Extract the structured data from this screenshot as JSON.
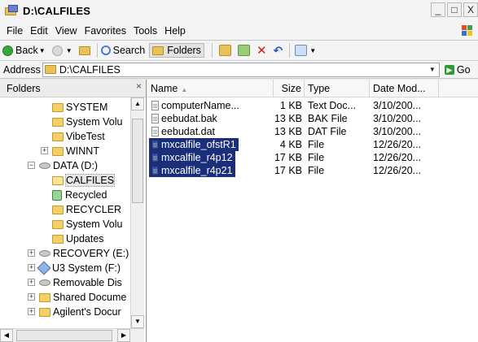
{
  "window": {
    "title": "D:\\CALFILES",
    "controls": {
      "minimize": "_",
      "maximize": "□",
      "close": "X"
    }
  },
  "menu": [
    "File",
    "Edit",
    "View",
    "Favorites",
    "Tools",
    "Help"
  ],
  "toolbar": {
    "back_label": "Back",
    "search_label": "Search",
    "folders_label": "Folders"
  },
  "address": {
    "label": "Address",
    "value": "D:\\CALFILES",
    "go_label": "Go"
  },
  "folders_pane": {
    "title": "Folders",
    "items": [
      {
        "label": "SYSTEM",
        "type": "folder"
      },
      {
        "label": "System Volu",
        "type": "folder"
      },
      {
        "label": "VibeTest",
        "type": "folder"
      },
      {
        "label": "WINNT",
        "type": "folder",
        "expander": "+"
      },
      {
        "label": "DATA (D:)",
        "type": "drive",
        "expander": "−"
      },
      {
        "label": "CALFILES",
        "type": "folder-open",
        "selected": true
      },
      {
        "label": "Recycled",
        "type": "recycle"
      },
      {
        "label": "RECYCLER",
        "type": "folder"
      },
      {
        "label": "System Volu",
        "type": "folder"
      },
      {
        "label": "Updates",
        "type": "folder"
      },
      {
        "label": "RECOVERY (E:)",
        "type": "drive",
        "expander": "+"
      },
      {
        "label": "U3 System (F:)",
        "type": "usb",
        "expander": "+"
      },
      {
        "label": "Removable Dis",
        "type": "drive",
        "expander": "+"
      },
      {
        "label": "Shared Docume",
        "type": "folder",
        "expander": "+"
      },
      {
        "label": "Agilent's Docur",
        "type": "folder",
        "expander": "+"
      }
    ]
  },
  "file_list": {
    "columns": {
      "name": "Name",
      "size": "Size",
      "type": "Type",
      "date": "Date Mod..."
    },
    "files": [
      {
        "name": "computerName...",
        "size": "1 KB",
        "type": "Text Doc...",
        "date": "3/10/200...",
        "selected": false
      },
      {
        "name": "eebudat.bak",
        "size": "13 KB",
        "type": "BAK File",
        "date": "3/10/200...",
        "selected": false
      },
      {
        "name": "eebudat.dat",
        "size": "13 KB",
        "type": "DAT File",
        "date": "3/10/200...",
        "selected": false
      },
      {
        "name": "mxcalfile_ofstR1",
        "size": "4 KB",
        "type": "File",
        "date": "12/26/20...",
        "selected": true
      },
      {
        "name": "mxcalfile_r4p12",
        "size": "17 KB",
        "type": "File",
        "date": "12/26/20...",
        "selected": true
      },
      {
        "name": "mxcalfile_r4p21",
        "size": "17 KB",
        "type": "File",
        "date": "12/26/20...",
        "selected": true
      }
    ]
  },
  "colors": {
    "selection": "#1a2e7a",
    "chrome": "#f4f4f4",
    "folder": "#f3cf6a"
  }
}
